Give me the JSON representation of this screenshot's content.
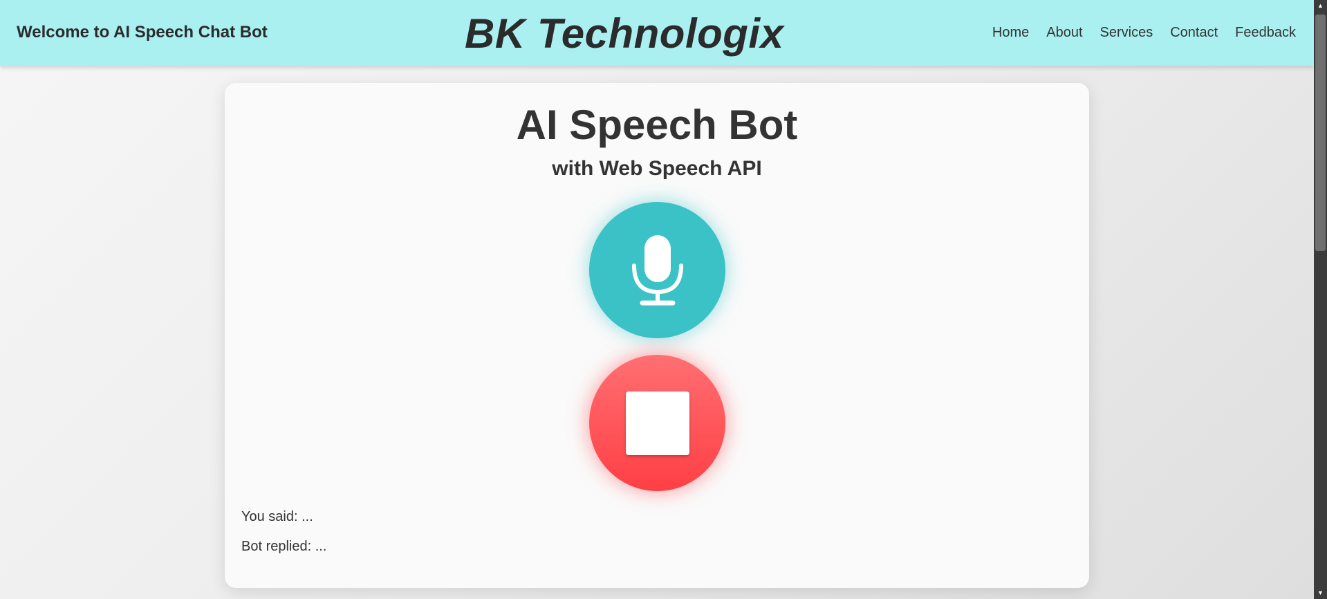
{
  "header": {
    "welcome": "Welcome to AI Speech Chat Bot",
    "brand": "BK Technologix",
    "nav": [
      "Home",
      "About",
      "Services",
      "Contact",
      "Feedback"
    ]
  },
  "main": {
    "title": "AI Speech Bot",
    "subtitle": "with Web Speech API",
    "mic_icon": "microphone-icon",
    "stop_icon": "stop-icon",
    "you_said": "You said: ...",
    "bot_replied": "Bot replied: ..."
  },
  "colors": {
    "header_bg": "#aaf0f1",
    "mic_button": "#3bc2c6",
    "stop_button": "#ff4a50"
  }
}
